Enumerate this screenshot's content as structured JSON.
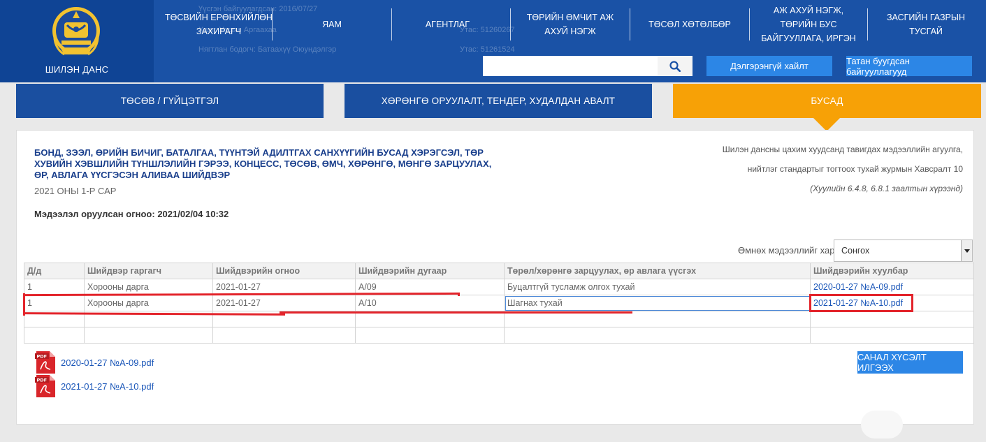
{
  "header": {
    "logo_title": "ШИЛЭН ДАНС",
    "background_text": [
      "Үүсгэн байгуулагдсан: 2016/07/27",
      "Хаяг: Улсын Аргаахаа",
      "Утас: 51260267",
      "Нягтлан бодогч: Батаахүү Оюундэлгэр",
      "Утас: 51261524"
    ],
    "nav": [
      "ТӨСВИЙН ЕРӨНХИЙЛӨН ЗАХИРАГЧ",
      "ЯАМ",
      "АГЕНТЛАГ",
      "ТӨРИЙН ӨМЧИТ АЖ АХУЙ НЭГЖ",
      "ТӨСӨЛ ХӨТӨЛБӨР",
      "АЖ АХУЙ НЭГЖ, ТӨРИЙН БУС БАЙГУУЛЛАГА, ИРГЭН",
      "ЗАСГИЙН ГАЗРЫН ТУСГАЙ"
    ],
    "search": {
      "value": "",
      "placeholder": ""
    },
    "advanced_search": "Дэлгэрэнгүй хайлт",
    "closed_orgs": "Татан буугдсан байгууллагууд"
  },
  "tabs": [
    {
      "label": "ТӨСӨВ / ГҮЙЦЭТГЭЛ"
    },
    {
      "label": "ХӨРӨНГӨ ОРУУЛАЛТ, ТЕНДЕР, ХУДАЛДАН АВАЛТ"
    },
    {
      "label": "БУСАД"
    }
  ],
  "content": {
    "title": "БОНД, ЗЭЭЛ, ӨРИЙН БИЧИГ, БАТАЛГАА, ТҮҮНТЭЙ АДИЛТГАХ САНХҮҮГИЙН БУСАД ХЭРЭГСЭЛ, ТӨР ХУВИЙН ХЭВШЛИЙН ТҮНШЛЭЛИЙН ГЭРЭЭ, КОНЦЕСС, ТӨСӨВ, ӨМЧ, ХӨРӨНГӨ, МӨНГӨ ЗАРЦУУЛАХ, ӨР, АВЛАГА ҮҮСГЭСЭН АЛИВАА ШИЙДВЭР",
    "period": "2021 ОНЫ 1-Р САР",
    "date_label": "Мэдээлэл оруулсан огноо:",
    "date_value": "2021/02/04 10:32",
    "note_line1": "Шилэн дансны цахим хуудсанд тавигдах мэдээллийн агуулга,",
    "note_line2": "нийтлэг стандартыг тогтоох тухай журмын Хавсралт 10",
    "note_line3": "(Хуулийн 6.4.8, 6.8.1 заалтын хүрээнд)",
    "prev_label": "Өмнөх мэдээллийг харах",
    "prev_select": "Сонгох"
  },
  "table": {
    "headers": [
      "Д/д",
      "Шийдвэр гаргагч",
      "Шийдвэрийн огноо",
      "Шийдвэрийн дугаар",
      "Төрөл/хөрөнгө зарцуулах, өр авлага үүсгэх",
      "Шийдвэрийн хуулбар"
    ],
    "rows": [
      [
        "1",
        "Хорооны дарга",
        "2021-01-27",
        "А/09",
        "Буцалтгүй тусламж олгох тухай",
        "2020-01-27 №А-09.pdf"
      ],
      [
        "1",
        "Хорооны дарга",
        "2021-01-27",
        "А/10",
        "Шагнах тухай",
        "2021-01-27 №А-10.pdf"
      ],
      [
        "",
        "",
        "",
        "",
        "",
        ""
      ],
      [
        "",
        "",
        "",
        "",
        "",
        ""
      ]
    ]
  },
  "attachments": [
    "2020-01-27 №А-09.pdf",
    "2021-01-27 №А-10.pdf"
  ],
  "feedback_button": "САНАЛ ХҮСЭЛТ ИЛГЭЭХ",
  "icons": {
    "search": "search-icon",
    "pdf": "pdf-file-icon",
    "emblem": "state-emblem-logo"
  },
  "colors": {
    "header": "#1a52a6",
    "tab": "#1a4fa0",
    "tab_active": "#f7a106",
    "button": "#2c86e6",
    "highlight": "#e3242b"
  }
}
